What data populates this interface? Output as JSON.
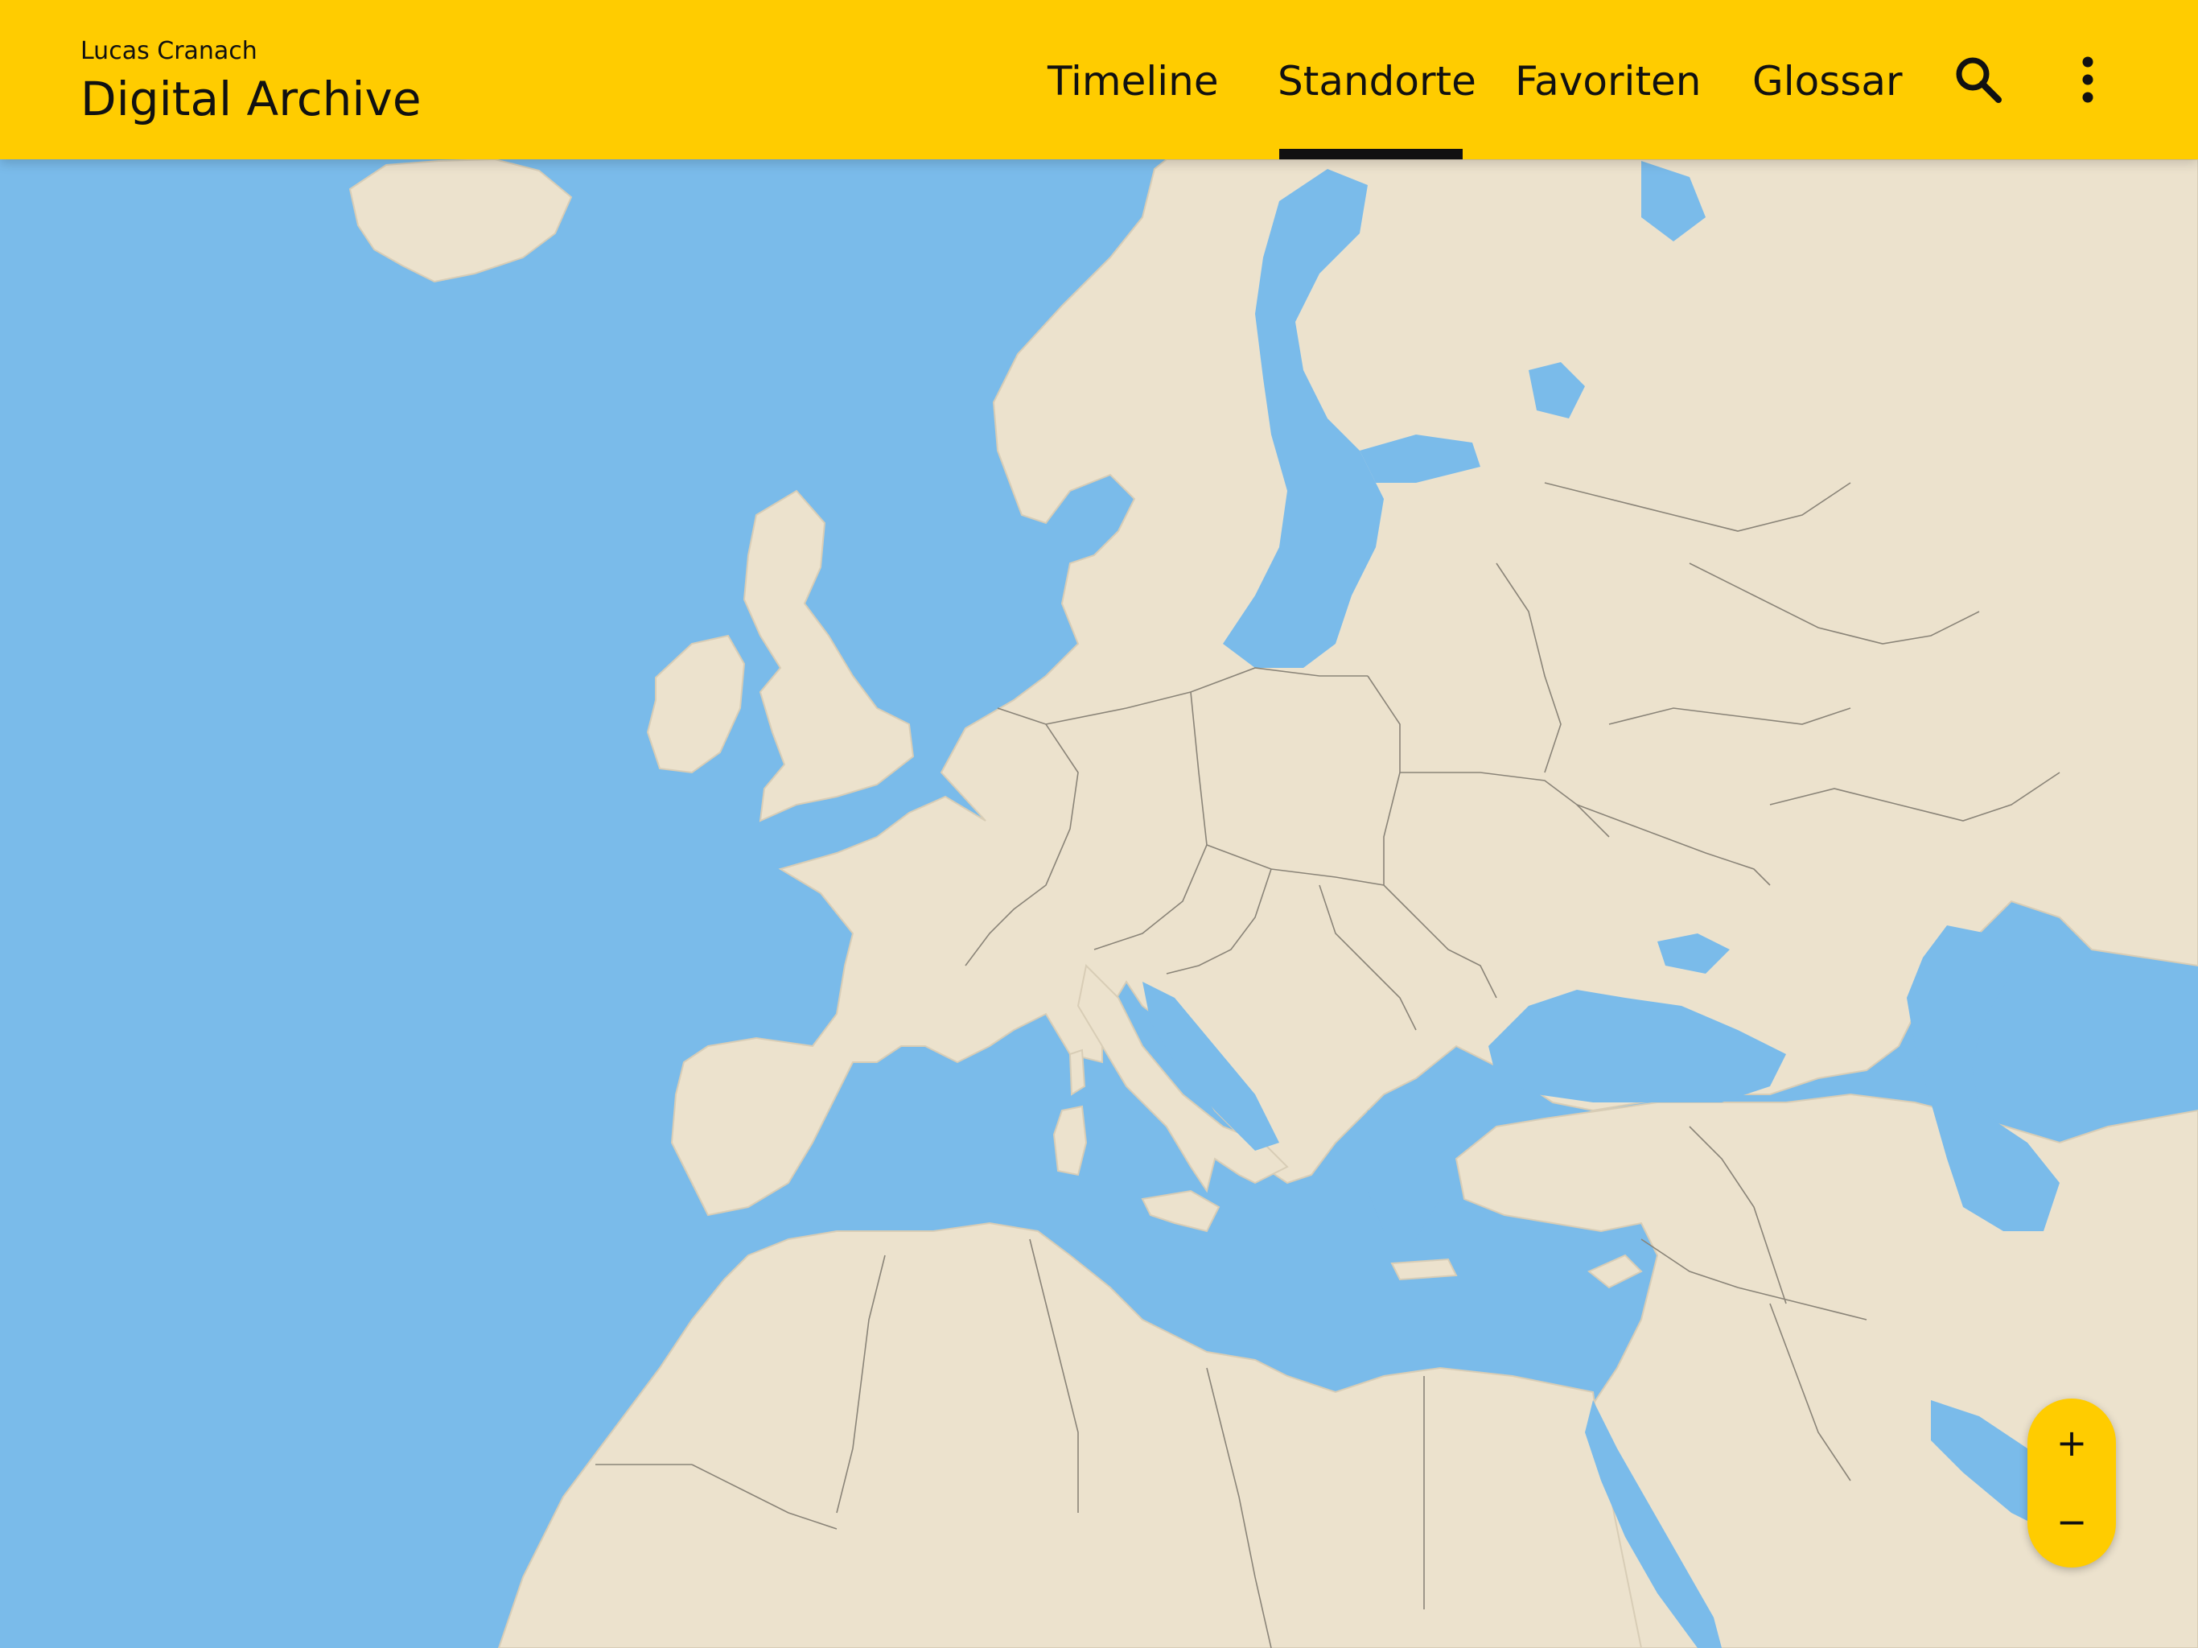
{
  "header": {
    "subtitle": "Lucas Cranach",
    "title": "Digital Archive"
  },
  "nav": {
    "items": [
      {
        "label": "Timeline"
      },
      {
        "label": "Standorte",
        "active": true
      },
      {
        "label": "Favoriten"
      },
      {
        "label": "Glossar"
      }
    ],
    "search_icon": "search-icon",
    "menu_icon": "more-vertical-icon"
  },
  "map": {
    "region": "Europe",
    "land_color": "#ece2cd",
    "water_color": "#7abbea",
    "border_color": "#8a8478"
  },
  "zoom": {
    "in_label": "+",
    "out_label": "−"
  },
  "colors": {
    "accent": "#ffcc00",
    "text": "#111111"
  }
}
